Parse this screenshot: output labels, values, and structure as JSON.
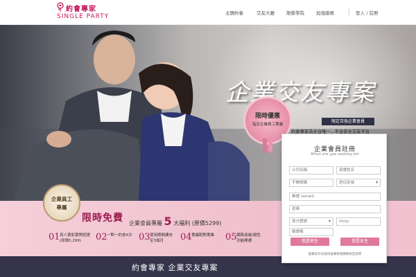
{
  "brand": {
    "name_cn": "約會專家",
    "name_en": "SINGLE PARTY"
  },
  "nav": {
    "items": [
      "主題約會",
      "交友大廳",
      "戀愛學院",
      "加值服務"
    ],
    "login": "登入 / 註冊"
  },
  "hero": {
    "headline": "企業交友專案",
    "badge_small": "限定百強企業會員",
    "promo_lines": [
      "約會專家為全台唯一...平台安全交友平台",
      "...針對單身...優秀的你",
      "限時免費加入約會專家真人認證會員"
    ],
    "rosette": {
      "title": "限時優惠",
      "subtitle": "指定企業員工專屬"
    }
  },
  "promo_band": {
    "medal_line1": "企業員工",
    "medal_line2": "專屬",
    "free_title": "限時免費",
    "benefit_prefix": "企業會員專屬",
    "benefit_count": "5",
    "benefit_suffix": "大福利 (原價5299)",
    "items": [
      {
        "num": "01",
        "line1": "真人實影實際認證",
        "line2": "(原價5,299)"
      },
      {
        "num": "02",
        "line1": "一對一約會4次",
        "line2": ""
      },
      {
        "num": "03",
        "line1": "使用期間擴充",
        "line2": "至3個月"
      },
      {
        "num": "04",
        "line1": "專屬配對專業",
        "line2": ""
      },
      {
        "num": "05",
        "line1": "網路遠端/個性",
        "line2": "功能開通"
      }
    ]
  },
  "form": {
    "title": "企業會員註冊",
    "subtitle": "What are you waiting for",
    "fields": {
      "company": "公司名稱",
      "name": "真實姓名",
      "phone": "手機號碼",
      "area": "居住區域",
      "email": "帳號 (email)",
      "password": "密碼",
      "id_number": "身分證號",
      "birthday": "Vicky",
      "captcha": "驗證碼"
    },
    "btn_male": "我是男生",
    "btn_female": "我是女生",
    "note": "點擊表示同意約會專家相關條款及說明"
  },
  "bottom": {
    "title": "約會專家 企業交友專案"
  },
  "colors": {
    "brand": "#c2185b",
    "accent_pink": "#e0799a",
    "dark_bar": "#35344b",
    "pink_band": "#f2c2d0"
  }
}
